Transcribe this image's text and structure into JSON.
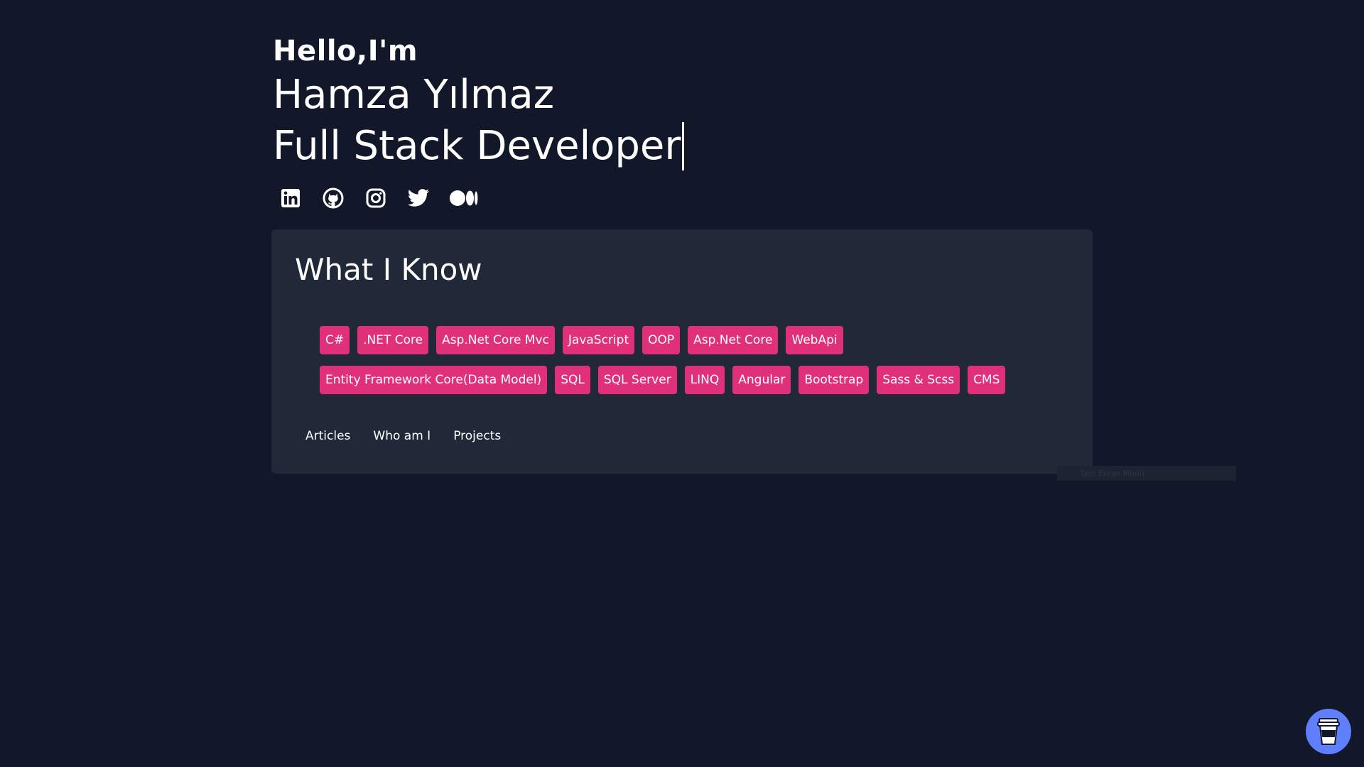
{
  "hero": {
    "greeting": "Hello,I'm",
    "name": "Hamza Yılmaz",
    "role": "Full Stack Developer"
  },
  "socials": [
    {
      "icon": "linkedin-icon"
    },
    {
      "icon": "github-icon"
    },
    {
      "icon": "instagram-icon"
    },
    {
      "icon": "twitter-icon"
    },
    {
      "icon": "medium-icon"
    }
  ],
  "skills": {
    "title": "What I Know",
    "tags": [
      "C#",
      ".NET Core",
      "Asp.Net Core Mvc",
      "JavaScript",
      "OOP",
      "Asp.Net Core",
      "WebApi",
      "Entity Framework Core(Data Model)",
      "SQL",
      "SQL Server",
      "LINQ",
      "Angular",
      "Bootstrap",
      "Sass & Scss",
      "CMS"
    ]
  },
  "tabs": [
    "Articles",
    "Who am I",
    "Projects"
  ],
  "tooltip": {
    "text": "Tam Ekran Modu"
  },
  "fab": {
    "icon": "coffee-cup-icon"
  },
  "colors": {
    "background": "#121829",
    "card": "#212939",
    "tag": "#e0307a",
    "fab": "#5f7fff"
  }
}
